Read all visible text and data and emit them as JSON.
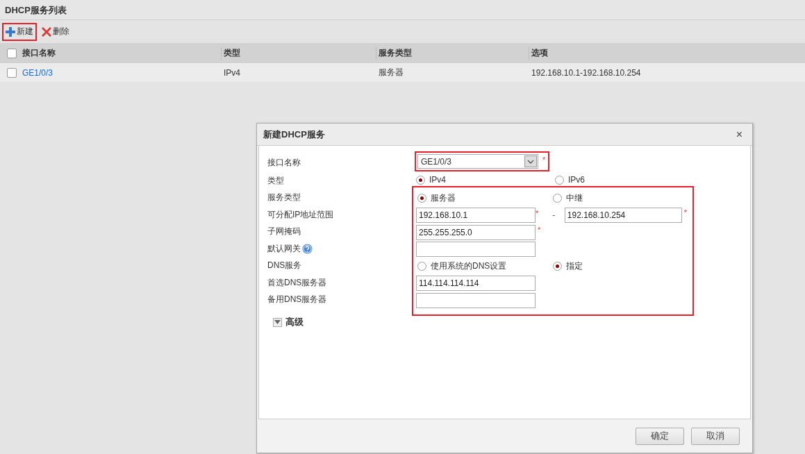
{
  "page_title": "DHCP服务列表",
  "toolbar": [
    {
      "kind": "add",
      "label": "新建",
      "highlighted": true
    },
    {
      "kind": "delete",
      "label": "删除",
      "highlighted": false
    }
  ],
  "table": {
    "header_checked": false,
    "columns": [
      "接口名称",
      "类型",
      "服务类型",
      "选项"
    ],
    "rows": [
      {
        "checked": false,
        "cells": [
          "GE1/0/3",
          "IPv4",
          "服务器",
          "192.168.10.1-192.168.10.254"
        ]
      }
    ]
  },
  "dialog": {
    "title": "新建DHCP服务",
    "close": "×",
    "fields": [
      {
        "kind": "select",
        "label": "接口名称",
        "value": "GE1/0/3",
        "required_mark": "*",
        "highlighted": true
      },
      {
        "kind": "radio",
        "label": "类型",
        "options": [
          {
            "label": "IPv4",
            "selected": true
          },
          {
            "label": "IPv6",
            "selected": false
          }
        ]
      }
    ],
    "highlighted_group": {
      "highlighted": true,
      "fields": [
        {
          "kind": "radio",
          "label": "服务类型",
          "options": [
            {
              "label": "服务器",
              "selected": true
            },
            {
              "label": "中继",
              "selected": false
            }
          ]
        },
        {
          "kind": "range",
          "label": "可分配IP地址范围",
          "from": "192.168.10.1",
          "from_required_mark": "*",
          "separator": "-",
          "to": "192.168.10.254",
          "to_required_mark": "*"
        },
        {
          "kind": "text",
          "label": "子网掩码",
          "value": "255.255.255.0",
          "required_mark": "*"
        },
        {
          "kind": "text",
          "label": "默认网关",
          "help": true
        },
        {
          "kind": "radio",
          "label": "DNS服务",
          "options": [
            {
              "label": "使用系统的DNS设置",
              "selected": false
            },
            {
              "label": "指定",
              "selected": true
            }
          ]
        },
        {
          "kind": "text",
          "label": "首选DNS服务器",
          "value": "114.114.114.114"
        },
        {
          "kind": "text",
          "label": "备用DNS服务器"
        }
      ]
    },
    "advanced": {
      "label": "高级",
      "expanded": false
    },
    "buttons": [
      "确定",
      "取消"
    ]
  }
}
